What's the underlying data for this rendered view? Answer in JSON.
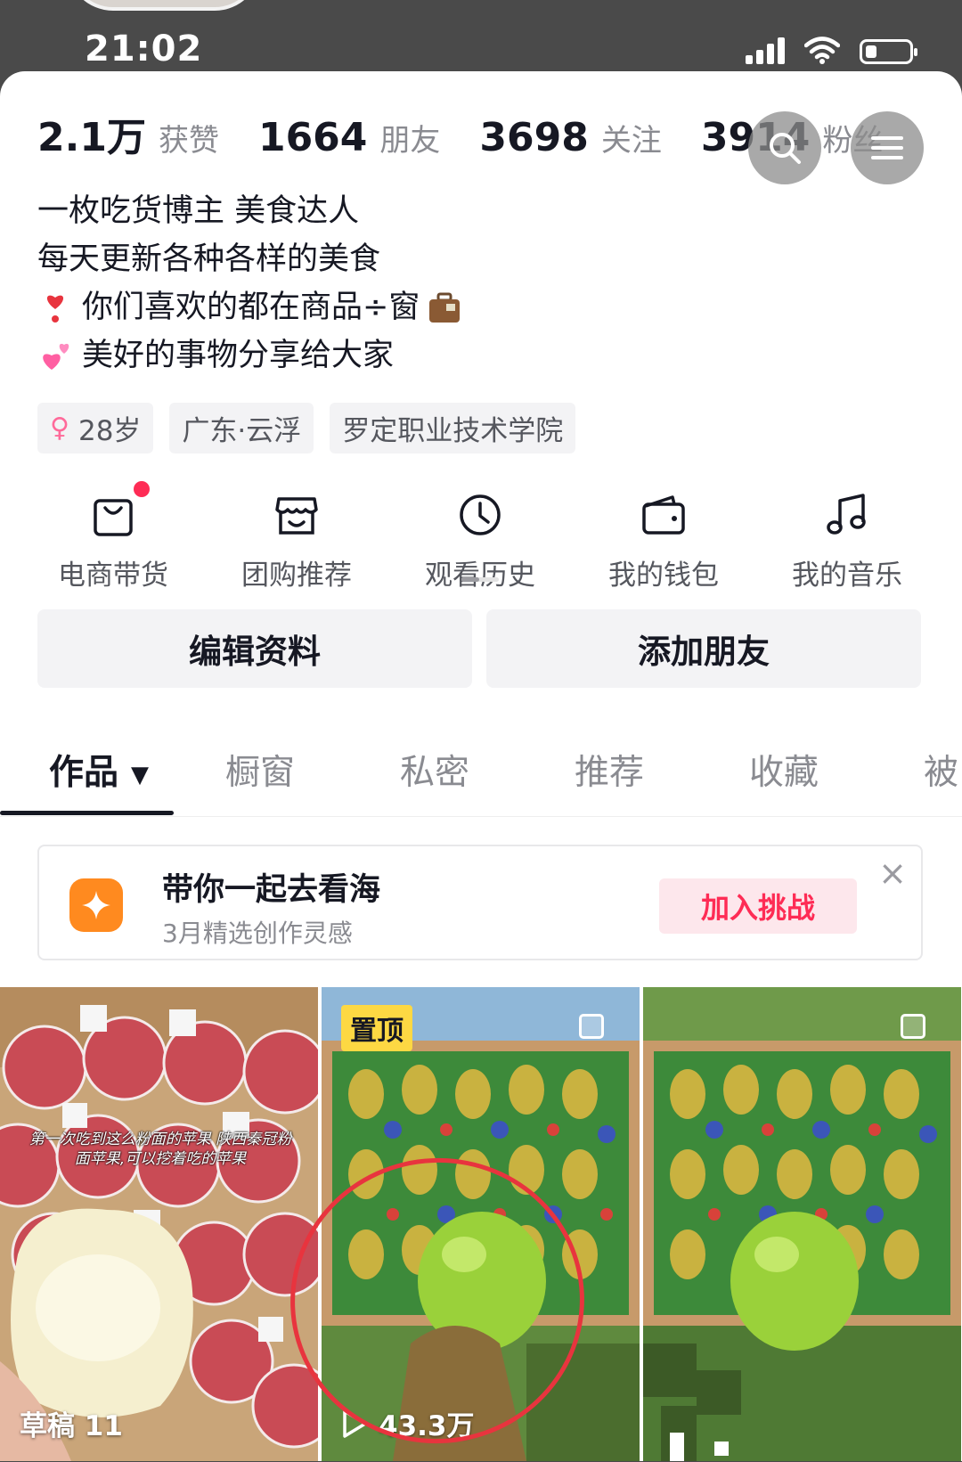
{
  "status_bar": {
    "time": "21:02"
  },
  "stats": [
    {
      "num": "2.1万",
      "label": "获赞"
    },
    {
      "num": "1664",
      "label": "朋友"
    },
    {
      "num": "3698",
      "label": "关注"
    },
    {
      "num": "3914",
      "label": "粉丝"
    }
  ],
  "bio": {
    "line1": "一枚吃货博主 美食达人",
    "line2": "每天更新各种各样的美食",
    "line3": "你们喜欢的都在商品÷窗",
    "line4": "美好的事物分享给大家"
  },
  "tags": {
    "age": "28岁",
    "location": "广东·云浮",
    "school": "罗定职业技术学院"
  },
  "quick_entries": [
    {
      "label": "电商带货",
      "icon": "shopping-bag-icon"
    },
    {
      "label": "团购推荐",
      "icon": "store-icon"
    },
    {
      "label": "观看历史",
      "icon": "clock-icon"
    },
    {
      "label": "我的钱包",
      "icon": "wallet-icon"
    },
    {
      "label": "我的音乐",
      "icon": "music-note-icon"
    }
  ],
  "actions": {
    "edit": "编辑资料",
    "add_friend": "添加朋友"
  },
  "tabs": [
    "作品",
    "橱窗",
    "私密",
    "推荐",
    "收藏",
    "被"
  ],
  "banner": {
    "title": "带你一起去看海",
    "subtitle": "3月精选创作灵感",
    "button": "加入挑战",
    "close": "×"
  },
  "grid": {
    "cell1": {
      "overlay": "第一次吃到这么粉面的苹果 陕西秦冠粉面苹果,可以挖着吃的苹果",
      "caption": "草稿 11"
    },
    "cell2": {
      "badge": "置顶",
      "views": "43.3万"
    }
  },
  "colors": {
    "accent": "#fe2c55",
    "pin": "#fdd843",
    "banner_icon": "#ff8a1f"
  }
}
